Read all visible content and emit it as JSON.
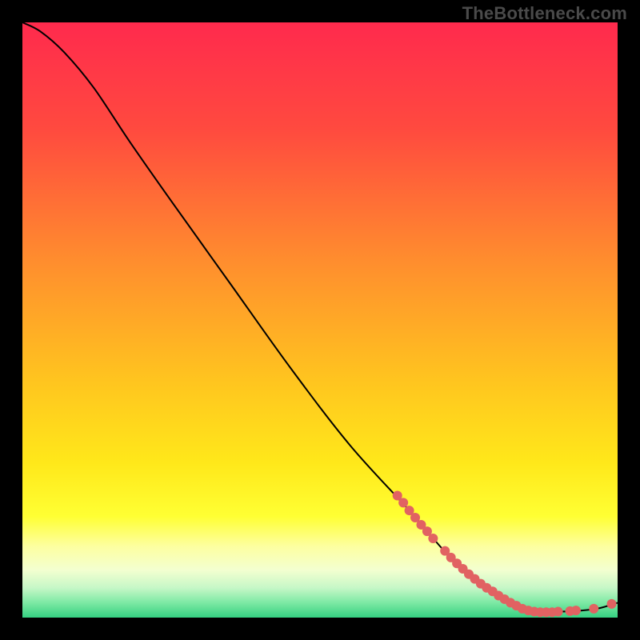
{
  "watermark": "TheBottleneck.com",
  "chart_data": {
    "type": "line",
    "title": "",
    "xlabel": "",
    "ylabel": "",
    "xlim": [
      0,
      100
    ],
    "ylim": [
      0,
      100
    ],
    "grid": false,
    "legend": false,
    "curve": [
      {
        "x": 0,
        "y": 100
      },
      {
        "x": 3,
        "y": 98.5
      },
      {
        "x": 7,
        "y": 95
      },
      {
        "x": 12,
        "y": 89
      },
      {
        "x": 18,
        "y": 80
      },
      {
        "x": 25,
        "y": 70
      },
      {
        "x": 35,
        "y": 56
      },
      {
        "x": 45,
        "y": 42
      },
      {
        "x": 55,
        "y": 29
      },
      {
        "x": 65,
        "y": 18
      },
      {
        "x": 72,
        "y": 10
      },
      {
        "x": 78,
        "y": 5
      },
      {
        "x": 83,
        "y": 2
      },
      {
        "x": 86,
        "y": 1
      },
      {
        "x": 90,
        "y": 1
      },
      {
        "x": 94,
        "y": 1.2
      },
      {
        "x": 97,
        "y": 1.6
      },
      {
        "x": 100,
        "y": 2.5
      }
    ],
    "markers": [
      {
        "x": 63,
        "y": 20.5
      },
      {
        "x": 64,
        "y": 19.3
      },
      {
        "x": 65,
        "y": 18.0
      },
      {
        "x": 66,
        "y": 16.8
      },
      {
        "x": 67,
        "y": 15.6
      },
      {
        "x": 68,
        "y": 14.5
      },
      {
        "x": 69,
        "y": 13.3
      },
      {
        "x": 71,
        "y": 11.2
      },
      {
        "x": 72,
        "y": 10.1
      },
      {
        "x": 73,
        "y": 9.1
      },
      {
        "x": 74,
        "y": 8.2
      },
      {
        "x": 75,
        "y": 7.3
      },
      {
        "x": 76,
        "y": 6.5
      },
      {
        "x": 77,
        "y": 5.7
      },
      {
        "x": 78,
        "y": 5.0
      },
      {
        "x": 79,
        "y": 4.4
      },
      {
        "x": 80,
        "y": 3.7
      },
      {
        "x": 81,
        "y": 3.1
      },
      {
        "x": 82,
        "y": 2.5
      },
      {
        "x": 83,
        "y": 2.0
      },
      {
        "x": 84,
        "y": 1.5
      },
      {
        "x": 85,
        "y": 1.2
      },
      {
        "x": 86,
        "y": 1.0
      },
      {
        "x": 87,
        "y": 0.9
      },
      {
        "x": 88,
        "y": 0.9
      },
      {
        "x": 89,
        "y": 0.9
      },
      {
        "x": 90,
        "y": 1.0
      },
      {
        "x": 92,
        "y": 1.1
      },
      {
        "x": 93,
        "y": 1.2
      },
      {
        "x": 96,
        "y": 1.5
      },
      {
        "x": 99,
        "y": 2.3
      }
    ],
    "marker_color": "#e16262",
    "line_color": "#000000",
    "gradient_stops": [
      {
        "offset": 0.0,
        "color": "#ff2a4d"
      },
      {
        "offset": 0.18,
        "color": "#ff4a3f"
      },
      {
        "offset": 0.4,
        "color": "#ff8d2e"
      },
      {
        "offset": 0.6,
        "color": "#ffc41f"
      },
      {
        "offset": 0.74,
        "color": "#ffe81a"
      },
      {
        "offset": 0.83,
        "color": "#ffff33"
      },
      {
        "offset": 0.88,
        "color": "#fdffa0"
      },
      {
        "offset": 0.92,
        "color": "#f3ffd0"
      },
      {
        "offset": 0.95,
        "color": "#c6f7c7"
      },
      {
        "offset": 0.975,
        "color": "#7de9a4"
      },
      {
        "offset": 1.0,
        "color": "#35d081"
      }
    ]
  }
}
